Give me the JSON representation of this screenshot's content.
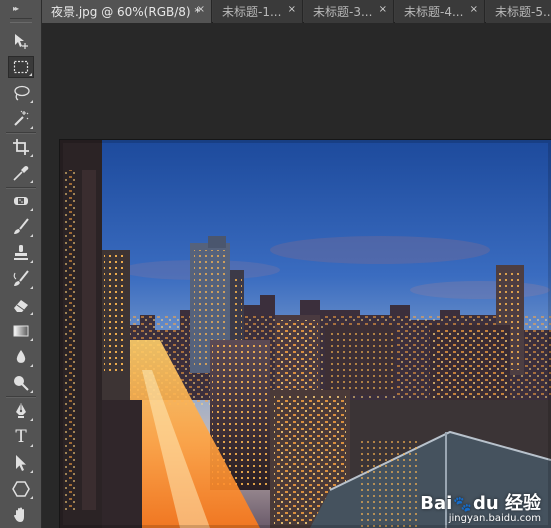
{
  "tabs": [
    {
      "label": "夜景.jpg @ 60%(RGB/8) *",
      "close": "×",
      "active": true
    },
    {
      "label": "未标题-1...",
      "close": "×",
      "active": false
    },
    {
      "label": "未标题-3...",
      "close": "×",
      "active": false
    },
    {
      "label": "未标题-4...",
      "close": "×",
      "active": false
    },
    {
      "label": "未标题-5...",
      "close": "×",
      "active": false
    }
  ],
  "toolbar": {
    "collapse_glyph": "▸▸",
    "tools": [
      {
        "name": "move-tool",
        "icon": "move-icon"
      },
      {
        "name": "rectangular-marquee-tool",
        "icon": "marquee-icon",
        "active": true
      },
      {
        "name": "lasso-tool",
        "icon": "lasso-icon"
      },
      {
        "name": "magic-wand-tool",
        "icon": "magic-wand-icon"
      },
      {
        "name": "crop-tool",
        "icon": "crop-icon"
      },
      {
        "name": "eyedropper-tool",
        "icon": "eyedropper-icon"
      },
      {
        "name": "spot-healing-tool",
        "icon": "bandage-icon"
      },
      {
        "name": "brush-tool",
        "icon": "brush-icon"
      },
      {
        "name": "clone-stamp-tool",
        "icon": "stamp-icon"
      },
      {
        "name": "history-brush-tool",
        "icon": "history-brush-icon"
      },
      {
        "name": "eraser-tool",
        "icon": "eraser-icon"
      },
      {
        "name": "gradient-tool",
        "icon": "gradient-icon"
      },
      {
        "name": "blur-tool",
        "icon": "blur-icon"
      },
      {
        "name": "dodge-tool",
        "icon": "dodge-icon"
      },
      {
        "name": "pen-tool",
        "icon": "pen-icon"
      },
      {
        "name": "type-tool",
        "icon": "type-icon",
        "glyph": "T"
      },
      {
        "name": "path-selection-tool",
        "icon": "arrow-icon"
      },
      {
        "name": "shape-tool",
        "icon": "polygon-icon"
      },
      {
        "name": "hand-tool",
        "icon": "hand-icon"
      }
    ]
  },
  "watermark": {
    "brand_left": "Bai",
    "brand_paw": "🐾",
    "brand_right": "du 经验",
    "url": "jingyan.baidu.com"
  },
  "colors": {
    "toolbar_bg": "#535353",
    "tabbar_bg": "#3d3d3d",
    "active_tab_bg": "#535353",
    "workspace_bg": "#282828",
    "sky_top": "#1f4fa0",
    "sky_bottom": "#9ab6d6",
    "city_light": "#ffb347"
  }
}
